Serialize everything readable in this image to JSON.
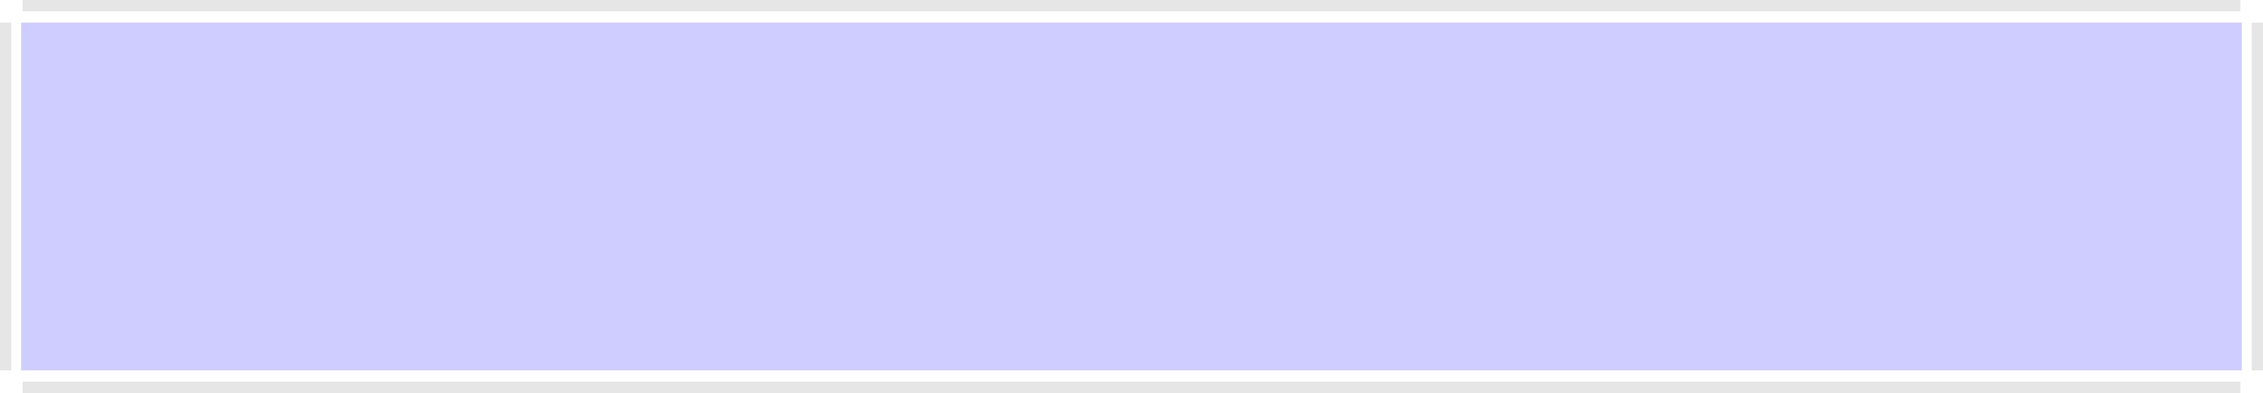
{
  "colors": {
    "selection_fill": "#cfcdff",
    "edge_handle": "#e6e6e6",
    "background": "#ffffff"
  },
  "selection": {
    "label": ""
  }
}
